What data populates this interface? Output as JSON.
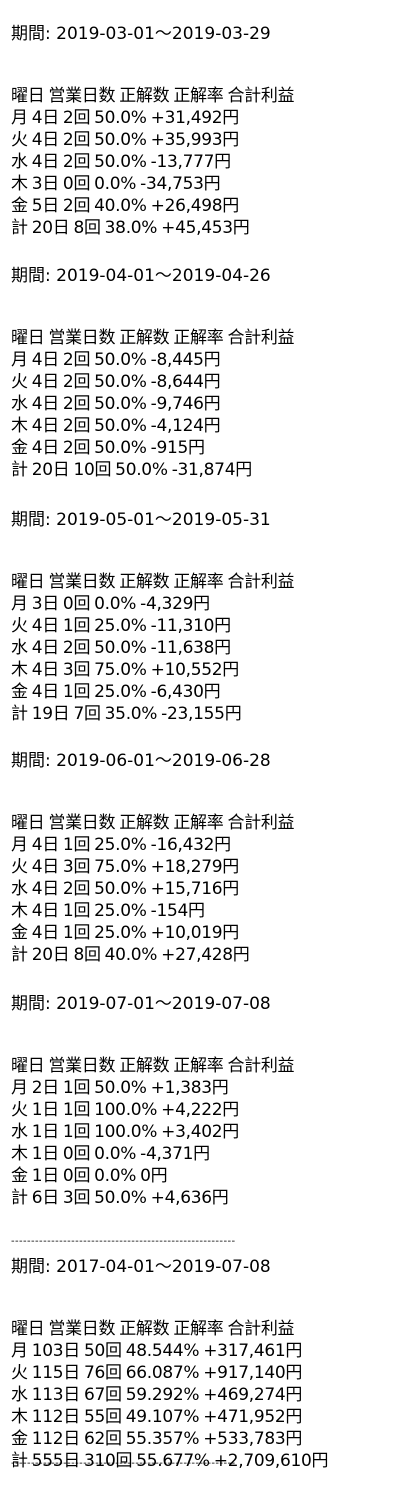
{
  "header_row": [
    "曜日",
    "営業日数",
    "正解数",
    "正解率",
    "合計利益"
  ],
  "divider": "--------------------------------------------------------",
  "sections": [
    {
      "period_label": "期間: 2019-03-01〜2019-03-29",
      "rows": [
        [
          "月",
          "4日",
          "2回",
          "50.0%",
          "+31,492円"
        ],
        [
          "火",
          "4日",
          "2回",
          "50.0%",
          "+35,993円"
        ],
        [
          "水",
          "4日",
          "2回",
          "50.0%",
          "-13,777円"
        ],
        [
          "木",
          "3日",
          "0回",
          "0.0%",
          "-34,753円"
        ],
        [
          "金",
          "5日",
          "2回",
          "40.0%",
          "+26,498円"
        ],
        [
          "計",
          "20日",
          "8回",
          "38.0%",
          "+45,453円"
        ]
      ]
    },
    {
      "period_label": "期間: 2019-04-01〜2019-04-26",
      "rows": [
        [
          "月",
          "4日",
          "2回",
          "50.0%",
          "-8,445円"
        ],
        [
          "火",
          "4日",
          "2回",
          "50.0%",
          "-8,644円"
        ],
        [
          "水",
          "4日",
          "2回",
          "50.0%",
          "-9,746円"
        ],
        [
          "木",
          "4日",
          "2回",
          "50.0%",
          "-4,124円"
        ],
        [
          "金",
          "4日",
          "2回",
          "50.0%",
          "-915円"
        ],
        [
          "計",
          "20日",
          "10回",
          "50.0%",
          "-31,874円"
        ]
      ]
    },
    {
      "period_label": "期間: 2019-05-01〜2019-05-31",
      "rows": [
        [
          "月",
          "3日",
          "0回",
          "0.0%",
          "-4,329円"
        ],
        [
          "火",
          "4日",
          "1回",
          "25.0%",
          "-11,310円"
        ],
        [
          "水",
          "4日",
          "2回",
          "50.0%",
          "-11,638円"
        ],
        [
          "木",
          "4日",
          "3回",
          "75.0%",
          "+10,552円"
        ],
        [
          "金",
          "4日",
          "1回",
          "25.0%",
          "-6,430円"
        ],
        [
          "計",
          "19日",
          "7回",
          "35.0%",
          "-23,155円"
        ]
      ]
    },
    {
      "period_label": "期間: 2019-06-01〜2019-06-28",
      "rows": [
        [
          "月",
          "4日",
          "1回",
          "25.0%",
          "-16,432円"
        ],
        [
          "火",
          "4日",
          "3回",
          "75.0%",
          "+18,279円"
        ],
        [
          "水",
          "4日",
          "2回",
          "50.0%",
          "+15,716円"
        ],
        [
          "木",
          "4日",
          "1回",
          "25.0%",
          "-154円"
        ],
        [
          "金",
          "4日",
          "1回",
          "25.0%",
          "+10,019円"
        ],
        [
          "計",
          "20日",
          "8回",
          "40.0%",
          "+27,428円"
        ]
      ]
    },
    {
      "period_label": "期間: 2019-07-01〜2019-07-08",
      "rows": [
        [
          "月",
          "2日",
          "1回",
          "50.0%",
          "+1,383円"
        ],
        [
          "火",
          "1日",
          "1回",
          "100.0%",
          "+4,222円"
        ],
        [
          "水",
          "1日",
          "1回",
          "100.0%",
          "+3,402円"
        ],
        [
          "木",
          "1日",
          "0回",
          "0.0%",
          "-4,371円"
        ],
        [
          "金",
          "1日",
          "0回",
          "0.0%",
          "0円"
        ],
        [
          "計",
          "6日",
          "3回",
          "50.0%",
          "+4,636円"
        ]
      ]
    },
    {
      "period_label": "期間: 2017-04-01〜2019-07-08",
      "rows": [
        [
          "月",
          "103日",
          "50回",
          "48.544%",
          "+317,461円"
        ],
        [
          "火",
          "115日",
          "76回",
          "66.087%",
          "+917,140円"
        ],
        [
          "水",
          "113日",
          "67回",
          "59.292%",
          "+469,274円"
        ],
        [
          "木",
          "112日",
          "55回",
          "49.107%",
          "+471,952円"
        ],
        [
          "金",
          "112日",
          "62回",
          "55.357%",
          "+533,783円"
        ],
        [
          "計",
          "555日",
          "310回",
          "55.677%",
          "+2,709,610円"
        ]
      ]
    }
  ]
}
